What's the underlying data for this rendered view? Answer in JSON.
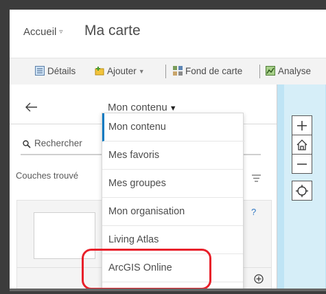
{
  "header": {
    "home_label": "Accueil",
    "home_caret": "▿",
    "map_title": "Ma carte"
  },
  "toolbar": {
    "details_label": "Détails",
    "add_label": "Ajouter",
    "basemap_label": "Fond de carte",
    "analysis_label": "Analyse"
  },
  "panel": {
    "content_selector": "Mon contenu",
    "search_placeholder": "Rechercher",
    "results_label": "Couches trouvé"
  },
  "dropdown": {
    "items": [
      {
        "label": "Mon contenu",
        "selected": true
      },
      {
        "label": "Mes favoris"
      },
      {
        "label": "Mes groupes"
      },
      {
        "label": "Mon organisation"
      },
      {
        "label": "Living Atlas"
      },
      {
        "label": "ArcGIS Online",
        "highlighted": true
      }
    ]
  },
  "map_controls": [
    "zoom-in-icon",
    "home-icon",
    "zoom-out-icon",
    "locate-icon"
  ],
  "colors": {
    "accent": "#0079c1",
    "highlight": "#e8202a",
    "map_water": "#bfe4f5"
  }
}
